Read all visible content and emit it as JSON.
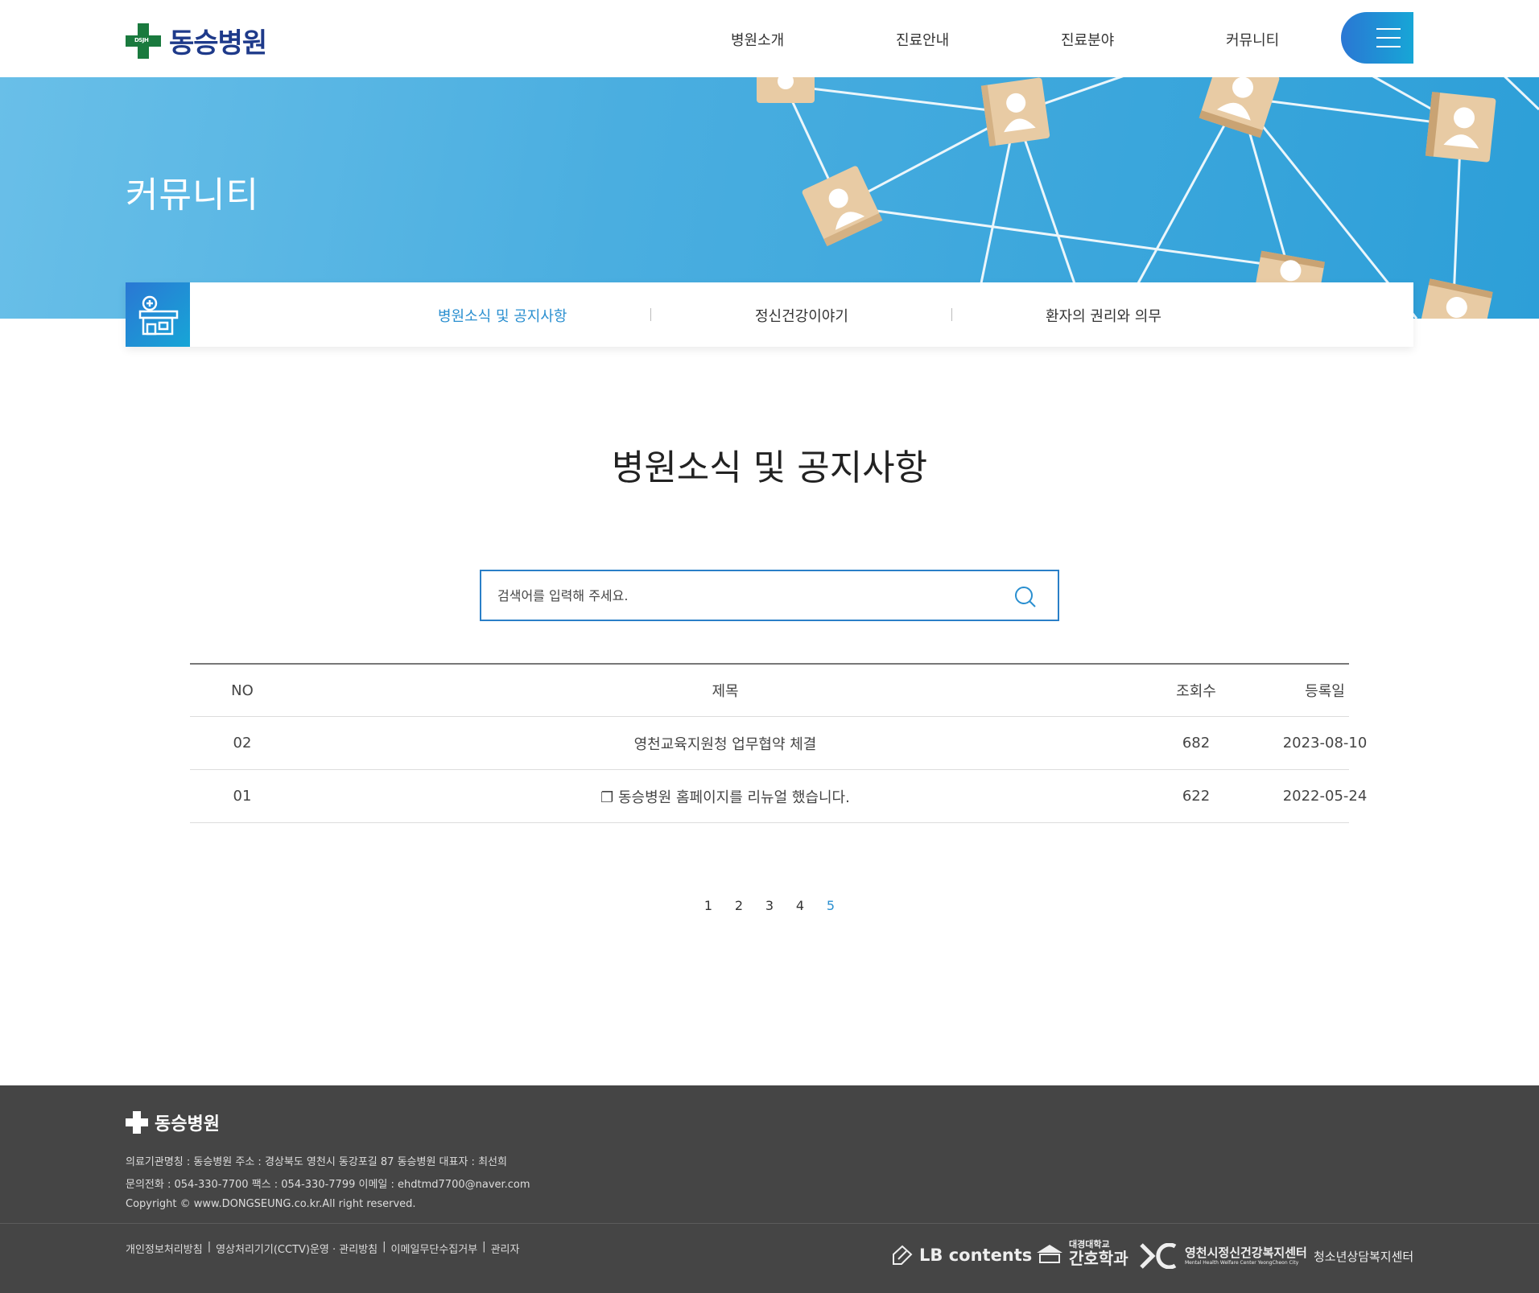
{
  "header": {
    "logo_text": "동승병원",
    "logo_tag": "DSJH",
    "nav": [
      "병원소개",
      "진료안내",
      "진료분야",
      "커뮤니티"
    ]
  },
  "banner": {
    "title": "커뮤니티"
  },
  "subnav": {
    "items": [
      "병원소식 및 공지사항",
      "정신건강이야기",
      "환자의 권리와 의무"
    ],
    "active_index": 0
  },
  "main": {
    "title": "병원소식 및 공지사항",
    "search": {
      "placeholder": "검색어를 입력해 주세요."
    },
    "table": {
      "headers": {
        "no": "NO",
        "title": "제목",
        "views": "조회수",
        "date": "등록일"
      },
      "rows": [
        {
          "no": "02",
          "title": "영천교육지원청 업무협약 체결",
          "views": "682",
          "date": "2023-08-10"
        },
        {
          "no": "01",
          "title": "❐ 동승병원 홈페이지를 리뉴얼 했습니다.",
          "views": "622",
          "date": "2022-05-24"
        }
      ]
    },
    "pagination": {
      "pages": [
        "1",
        "2",
        "3",
        "4",
        "5"
      ],
      "current": "5"
    }
  },
  "footer": {
    "logo_text": "동승병원",
    "info_lines": [
      "의료기관명칭 : 동승병원   주소 : 경상북도 영천시 동강포길 87 동승병원   대표자 : 최선희",
      "문의전화 : 054-330-7700   팩스 : 054-330-7799   이메일 : ehdtmd7700@naver.com",
      "Copyright © www.DONGSEUNG.co.kr.All right reserved."
    ],
    "links": [
      "개인정보처리방침",
      "영상처리기기(CCTV)운영 · 관리방침",
      "이메일무단수집거부",
      "관리자"
    ],
    "partners": {
      "lb": "LB contents",
      "dk_small": "대경대학교",
      "dk_big": "간호학과",
      "yc_title": "영천시정신건강복지센터",
      "yc_sub": "Mental Health Welfare Center YeongCheon City",
      "youth": "청소년상담복지센터"
    }
  },
  "colors": {
    "brand_green": "#1a7a3e",
    "brand_navy": "#1e3a8a",
    "accent_blue": "#2a8fd0",
    "footer_bg": "#454545"
  }
}
